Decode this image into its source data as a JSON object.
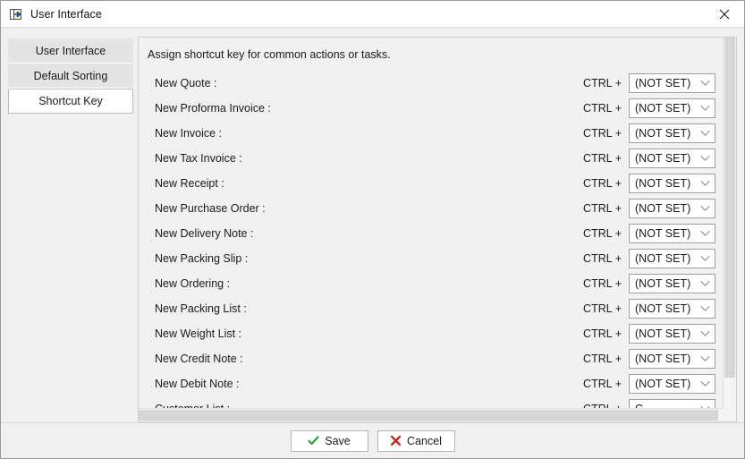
{
  "window": {
    "title": "User Interface",
    "title_icon": "open-window-arrow-icon",
    "close_icon": "close-icon"
  },
  "sidebar": {
    "items": [
      {
        "label": "User Interface",
        "active": false
      },
      {
        "label": "Default Sorting",
        "active": false
      },
      {
        "label": "Shortcut Key",
        "active": true
      }
    ]
  },
  "main": {
    "description": "Assign shortcut key for common actions or tasks.",
    "modifier_label": "CTRL +",
    "rows": [
      {
        "label": "New Quote :",
        "value": "(NOT SET)"
      },
      {
        "label": "New Proforma Invoice :",
        "value": "(NOT SET)"
      },
      {
        "label": "New Invoice :",
        "value": "(NOT SET)"
      },
      {
        "label": "New Tax Invoice :",
        "value": "(NOT SET)"
      },
      {
        "label": "New Receipt :",
        "value": "(NOT SET)"
      },
      {
        "label": "New Purchase Order :",
        "value": "(NOT SET)"
      },
      {
        "label": "New Delivery Note :",
        "value": "(NOT SET)"
      },
      {
        "label": "New Packing Slip :",
        "value": "(NOT SET)"
      },
      {
        "label": "New Ordering :",
        "value": "(NOT SET)"
      },
      {
        "label": "New Packing List :",
        "value": "(NOT SET)"
      },
      {
        "label": "New Weight List :",
        "value": "(NOT SET)"
      },
      {
        "label": "New Credit Note :",
        "value": "(NOT SET)"
      },
      {
        "label": "New Debit Note :",
        "value": "(NOT SET)"
      },
      {
        "label": "Customer List :",
        "value": "C"
      }
    ]
  },
  "footer": {
    "save_label": "Save",
    "save_icon": "check-icon",
    "cancel_label": "Cancel",
    "cancel_icon": "cross-icon"
  },
  "colors": {
    "save_check": "#2d9a34",
    "cancel_cross": "#d0211c",
    "active_tab_bg": "#ffffff",
    "tab_bg": "#e4e4e4"
  }
}
